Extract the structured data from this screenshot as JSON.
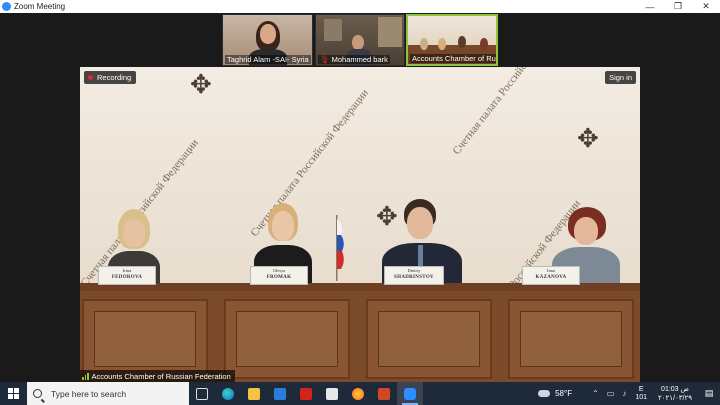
{
  "window": {
    "title": "Zoom Meeting",
    "minimize": "—",
    "restore": "❐",
    "close": "✕"
  },
  "thumbnails": [
    {
      "name": "Taghrid Alam -SAI- Syria"
    },
    {
      "name": "Mohammed bark"
    },
    {
      "name": "Accounts Chamber of Rus..."
    }
  ],
  "main_video": {
    "recording_label": "Recording",
    "signin_label": "Sign in",
    "speaker_label": "Accounts Chamber of Russian Federation",
    "wall_texts": [
      "Счетная палата Российской Федерации",
      "Счетная палата Российской Федерации",
      "Счетная палата Российской Федерации",
      "Российской Федерации"
    ],
    "nameplates": [
      {
        "first": "Irina",
        "last": "FEDOROVA"
      },
      {
        "first": "Olesya",
        "last": "FROMAK"
      },
      {
        "first": "Dmitry",
        "last": "SHADRINSTOV"
      },
      {
        "first": "Inna",
        "last": "KAZANOVA"
      }
    ]
  },
  "taskbar": {
    "search_placeholder": "Type here to search",
    "apps": [
      "task-view",
      "edge",
      "file-explorer",
      "mail",
      "acrobat",
      "store",
      "firefox",
      "powerpoint",
      "zoom"
    ],
    "weather": "58°F",
    "lang_top": "E",
    "lang_bottom": "101",
    "time": "01:03 ص",
    "date": "٢٠٢١/٠٣/٢٩"
  },
  "colors": {
    "active_speaker": "#8cc63f",
    "recording_dot": "#e02828",
    "taskbar": "#1e2a3a"
  }
}
